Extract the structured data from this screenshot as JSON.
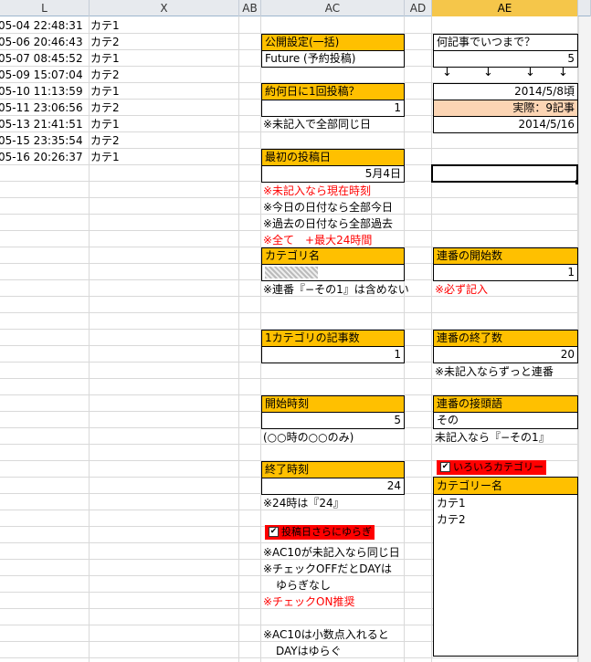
{
  "columns": [
    "L",
    "X",
    "AB",
    "AC",
    "AD",
    "AE"
  ],
  "log_rows": [
    {
      "date": "05-04 22:48:31",
      "category": "カテ1"
    },
    {
      "date": "05-06 20:46:43",
      "category": "カテ2"
    },
    {
      "date": "05-07 08:45:52",
      "category": "カテ1"
    },
    {
      "date": "05-09 15:07:04",
      "category": "カテ2"
    },
    {
      "date": "05-10 11:13:59",
      "category": "カテ1"
    },
    {
      "date": "05-11 23:06:56",
      "category": "カテ2"
    },
    {
      "date": "05-13 21:41:51",
      "category": "カテ1"
    },
    {
      "date": "05-15 23:35:54",
      "category": "カテ2"
    },
    {
      "date": "05-16 20:26:37",
      "category": "カテ1"
    }
  ],
  "left": {
    "publish_setting": {
      "title": "公開設定(一括)",
      "value": "Future (予約投稿)"
    },
    "interval": {
      "title": "約何日に1回投稿？",
      "value": "1",
      "note": "※未記入で全部同じ日"
    },
    "first_date": {
      "title": "最初の投稿日",
      "value": "5月4日",
      "notes": [
        "※未記入なら現在時刻",
        "※今日の日付なら全部今日",
        "※過去の日付なら全部過去",
        "※全て　+最大24時間"
      ]
    },
    "category_name": {
      "title": "カテゴリ名",
      "note": "※連番『−その1』は含めない"
    },
    "per_category": {
      "title": "1カテゴリの記事数",
      "value": "1"
    },
    "start_hour": {
      "title": "開始時刻",
      "value": "5",
      "note": "(○○時の○○のみ)"
    },
    "end_hour": {
      "title": "終了時刻",
      "value": "24",
      "note": "※24時は『24』"
    },
    "jitter_checkbox": {
      "label": "投稿日さらにゆらぎ",
      "checked": true
    },
    "jitter_notes": [
      "※AC10が未記入なら同じ日",
      "※チェックOFFだとDAYは",
      "ゆらぎなし",
      "※チェックON推奨",
      "※AC10は小数点入れると",
      "DAYはゆらぐ"
    ]
  },
  "right": {
    "until": {
      "title": "何記事でいつまで？",
      "value": "5"
    },
    "arrows": [
      "↓",
      "↓",
      "↓",
      "↓"
    ],
    "approx_date": "2014/5/8頃",
    "actual": "実際：9記事",
    "end_date": "2014/5/16",
    "serial_start": {
      "title": "連番の開始数",
      "value": "1",
      "note": "※必ず記入"
    },
    "serial_end": {
      "title": "連番の終了数",
      "value": "20",
      "note": "※未記入ならずっと連番"
    },
    "serial_prefix": {
      "title": "連番の接頭語",
      "value": "その",
      "note": "未記入なら『−その1』"
    },
    "multi_category_checkbox": {
      "label": "いろいろカテゴリー",
      "checked": true
    },
    "category_list": {
      "header": "カテゴリー名",
      "items": [
        "カテ1",
        "カテ2"
      ]
    }
  },
  "colors": {
    "header_orange": "#ffc000",
    "peach": "#fcd5b4",
    "red": "#ff0000",
    "selected_col": "#f5c64a"
  }
}
